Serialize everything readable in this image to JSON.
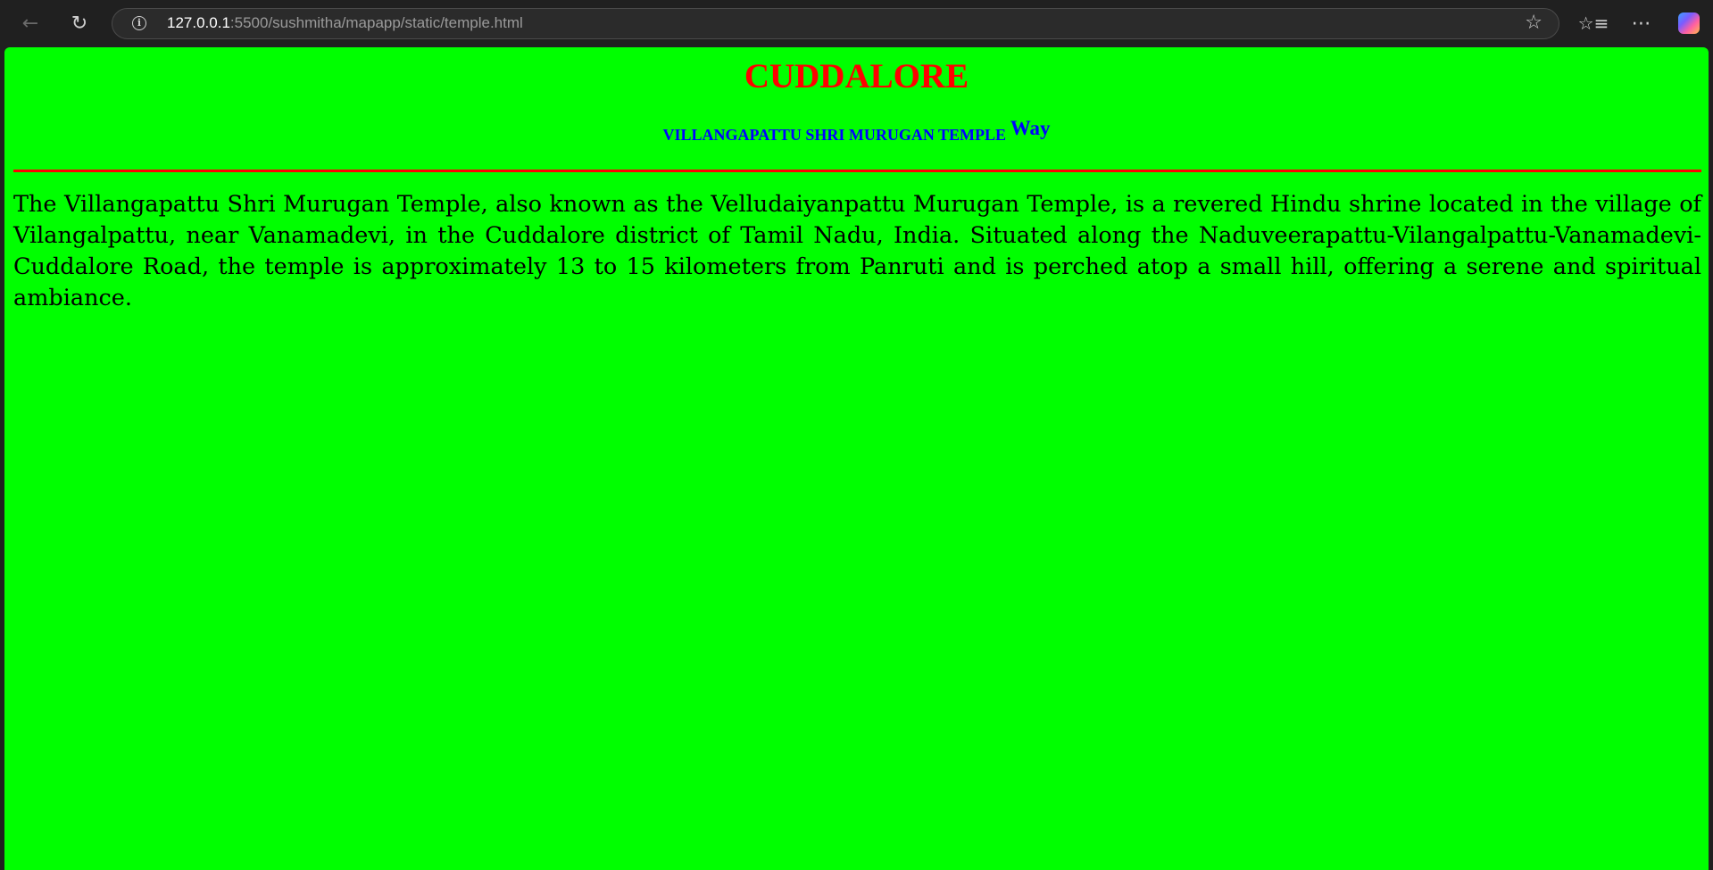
{
  "browser": {
    "back_icon": "arrow-left-icon",
    "reload_icon": "reload-icon",
    "url_host": "127.0.0.1",
    "url_rest": ":5500/sushmitha/mapapp/static/temple.html",
    "info_icon": "info-icon",
    "star_icon": "star-icon",
    "favorites_icon": "favorites-icon",
    "more_icon": "more-icon",
    "copilot_icon": "copilot-icon"
  },
  "page": {
    "background_color": "#00ff00",
    "title": "CUDDALORE",
    "title_color": "#ff0000",
    "subheading": "VILLANGAPATTU SHRI MURUGAN TEMPLE",
    "subheading_link": "Way",
    "subheading_color": "#0000ff",
    "divider_color": "#ff0000",
    "description": "The Villangapattu Shri Murugan Temple, also known as the Velludaiyanpattu Murugan Temple, is a revered Hindu shrine located in the village of Vilangalpattu, near Vanamadevi, in the Cuddalore district of Tamil Nadu, India. Situated along the Naduveerapattu-Vilangalpattu-Vanamadevi-Cuddalore Road, the temple is approximately 13 to 15 kilometers from Panruti and is perched atop a small hill, offering a serene and spiritual ambiance."
  }
}
